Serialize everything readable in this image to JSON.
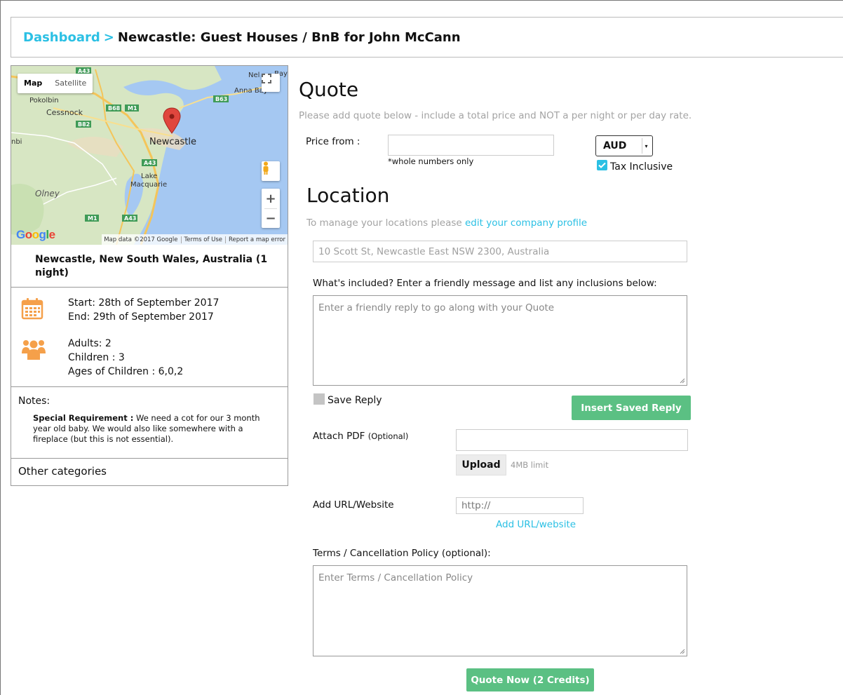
{
  "breadcrumb": {
    "link": "Dashboard",
    "separator": ">",
    "title": "Newcastle: Guest Houses / BnB for John McCann"
  },
  "map": {
    "type_map": "Map",
    "type_satellite": "Satellite",
    "places": [
      "Pokolbin",
      "Cessnock",
      "Newcastle",
      "Lake",
      "Macquarie",
      "Olney",
      "Anna Bay",
      "Nel",
      "Bay",
      "nbi"
    ],
    "road_labels": [
      "A43",
      "B68",
      "M1",
      "B82",
      "B63",
      "A43",
      "M1",
      "A43"
    ],
    "attribution": [
      "Map data ©2017 Google",
      "Terms of Use",
      "Report a map error"
    ],
    "logo": "Google",
    "zoom_in": "+",
    "zoom_out": "−"
  },
  "location": {
    "title": "Newcastle, New South Wales, Australia (1 night)"
  },
  "stay": {
    "start": "Start: 28th of September 2017",
    "end": "End: 29th of September 2017",
    "adults": "Adults: 2",
    "children": "Children : 3",
    "ages": "Ages of Children : 6,0,2"
  },
  "notes": {
    "heading": "Notes:",
    "label": "Special Requirement :",
    "text": " We need a cot for our 3 month year old baby. We would also like somewhere with a fireplace (but this is not essential)."
  },
  "other_categories": "Other categories",
  "quote": {
    "heading": "Quote",
    "hint": "Please add quote below - include a total price and NOT a per night or per day rate.",
    "price_label": "Price from :",
    "price_value": "",
    "price_note": "*whole numbers only",
    "currency": "AUD",
    "tax_label": "Tax Inclusive",
    "tax_checked": true
  },
  "location_section": {
    "heading": "Location",
    "hint_prefix": "To manage your locations please ",
    "hint_link": "edit your company profile",
    "address": "10 Scott St, Newcastle East NSW 2300, Australia"
  },
  "included": {
    "label": "What's included? Enter a friendly message and list any inclusions below:",
    "placeholder": "Enter a friendly reply to go along with your Quote"
  },
  "save_reply": {
    "label": "Save Reply",
    "checked": false
  },
  "insert_saved_reply": "Insert Saved Reply",
  "attach": {
    "label": "Attach PDF",
    "optional": "(Optional)",
    "upload": "Upload",
    "limit": "4MB limit"
  },
  "url": {
    "label": "Add URL/Website",
    "placeholder": "http://",
    "add_link": "Add URL/website"
  },
  "terms": {
    "label": "Terms / Cancellation Policy (optional):",
    "placeholder": "Enter Terms / Cancellation Policy"
  },
  "submit": "Quote Now (2 Credits)",
  "colors": {
    "accent": "#2bc0e4",
    "green": "#5bc083",
    "orange": "#f5a04a",
    "pin": "#e0463d"
  }
}
